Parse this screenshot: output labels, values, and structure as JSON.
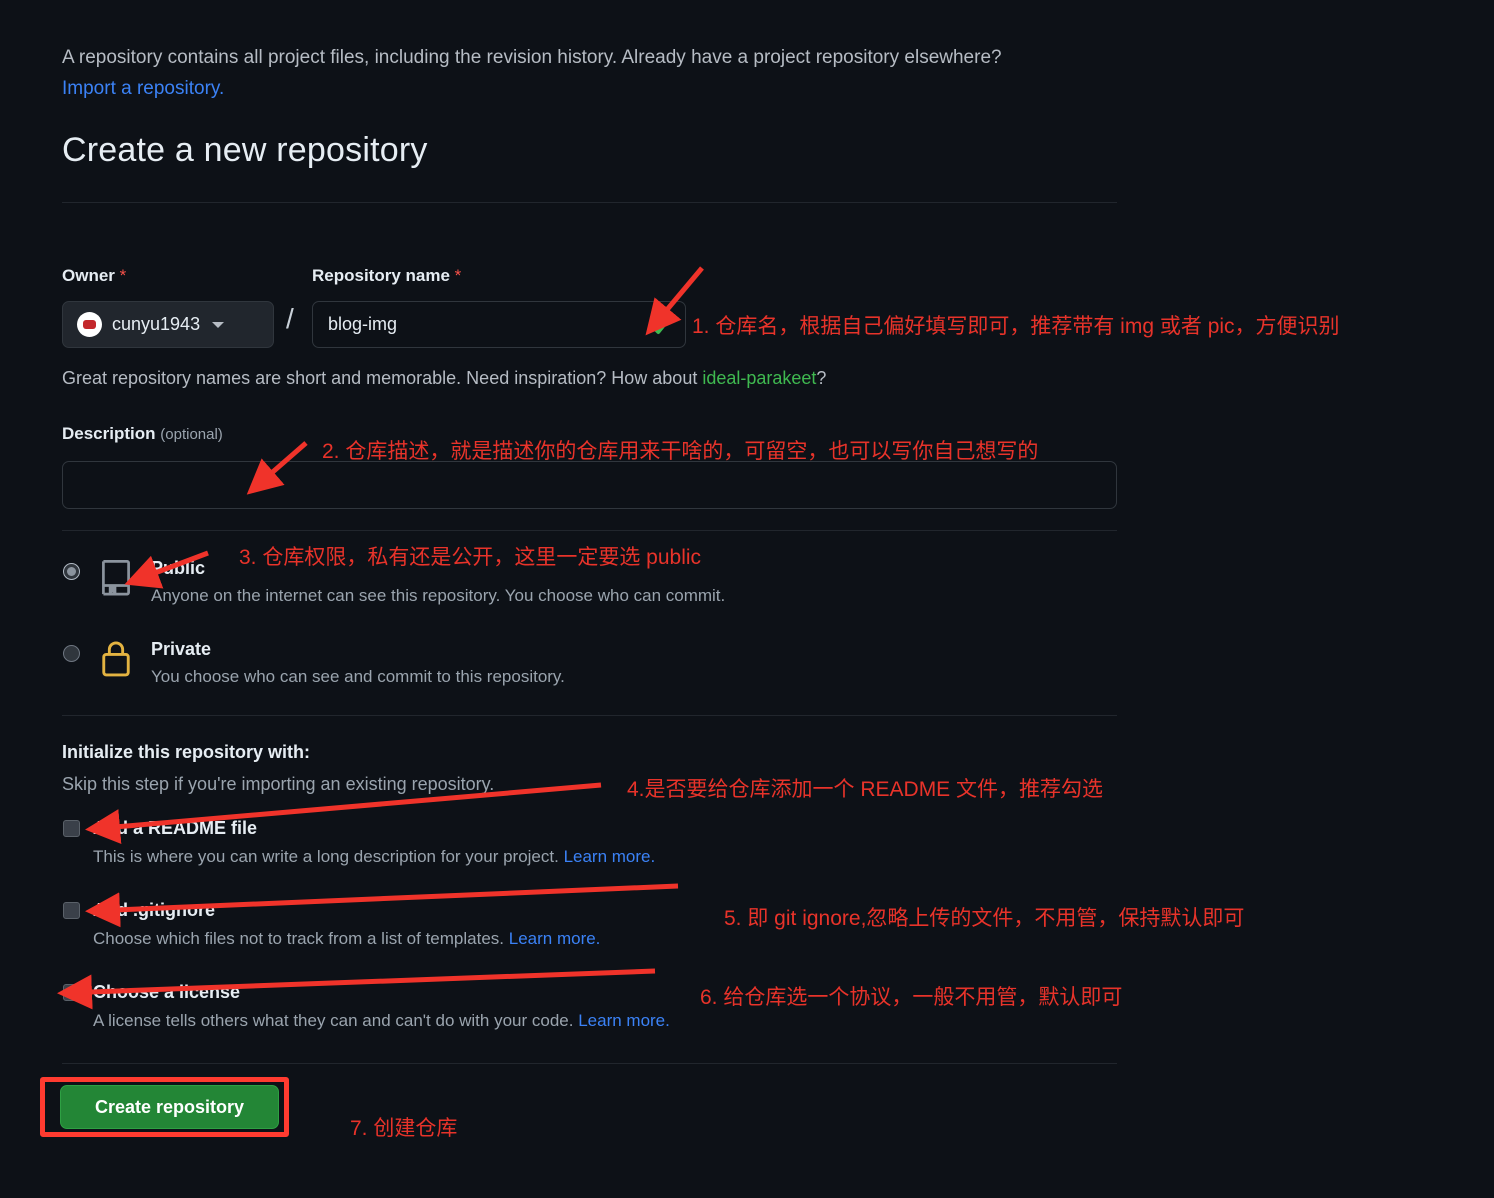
{
  "intro": {
    "text": "A repository contains all project files, including the revision history. Already have a project repository elsewhere?",
    "import_link": "Import a repository."
  },
  "page_title": "Create a new repository",
  "form": {
    "owner_label": "Owner",
    "owner_required": "*",
    "owner_value": "cunyu1943",
    "separator": "/",
    "repo_label": "Repository name",
    "repo_required": "*",
    "repo_value": "blog-img",
    "repo_placeholder": "",
    "repo_valid_icon": "check-icon",
    "hint_prefix": "Great repository names are short and memorable. Need inspiration? How about ",
    "hint_suggestion": "ideal-parakeet",
    "hint_suffix": "?",
    "description_label": "Description",
    "description_optional": "(optional)",
    "description_value": "",
    "description_placeholder": ""
  },
  "visibility": {
    "public": {
      "title": "Public",
      "desc": "Anyone on the internet can see this repository. You choose who can commit.",
      "selected": true,
      "icon": "repo-book-icon"
    },
    "private": {
      "title": "Private",
      "desc": "You choose who can see and commit to this repository.",
      "selected": false,
      "icon": "lock-icon"
    }
  },
  "initialize": {
    "section_title": "Initialize this repository with:",
    "section_sub": "Skip this step if you're importing an existing repository.",
    "options": [
      {
        "title": "Add a README file",
        "desc": "This is where you can write a long description for your project.",
        "link": "Learn more.",
        "checked": false
      },
      {
        "title": "Add .gitignore",
        "desc": "Choose which files not to track from a list of templates.",
        "link": "Learn more.",
        "checked": false
      },
      {
        "title": "Choose a license",
        "desc": "A license tells others what they can and can't do with your code.",
        "link": "Learn more.",
        "checked": false
      }
    ]
  },
  "create_button": "Create repository",
  "annotations": [
    {
      "id": 1,
      "text": "1. 仓库名，根据自己偏好填写即可，推荐带有 img 或者 pic，方便识别"
    },
    {
      "id": 2,
      "text": "2. 仓库描述，就是描述你的仓库用来干啥的，可留空，也可以写你自己想写的"
    },
    {
      "id": 3,
      "text": "3. 仓库权限，私有还是公开，这里一定要选 public"
    },
    {
      "id": 4,
      "text": "4.是否要给仓库添加一个 README 文件，推荐勾选"
    },
    {
      "id": 5,
      "text": "5. 即 git ignore,忽略上传的文件，不用管，保持默认即可"
    },
    {
      "id": 6,
      "text": "6. 给仓库选一个协议，一般不用管，默认即可"
    },
    {
      "id": 7,
      "text": "7. 创建仓库"
    }
  ],
  "colors": {
    "background": "#0d1117",
    "annotation_red": "#e8332a",
    "highlight_red": "#ff3b30",
    "link_blue": "#3b82f6",
    "success_green": "#3fb950",
    "button_green": "#238636",
    "lock_yellow": "#e3b341"
  }
}
